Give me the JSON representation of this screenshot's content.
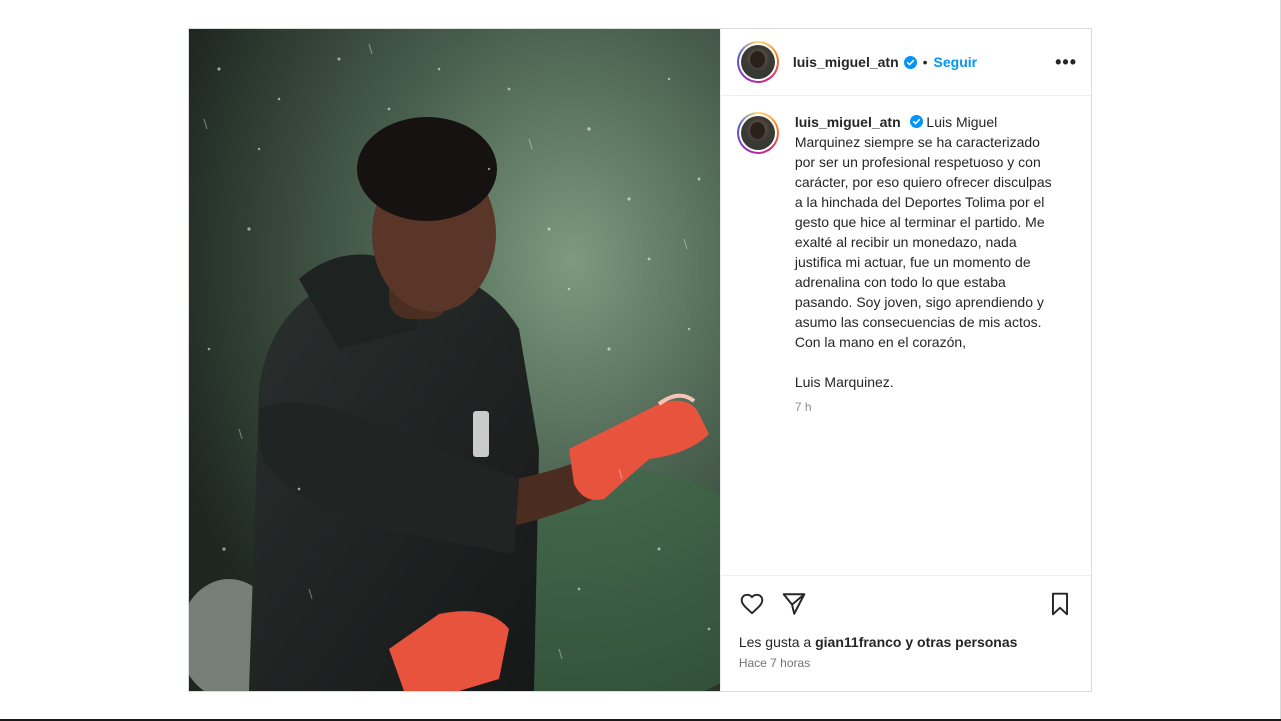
{
  "post": {
    "media": {
      "alt_icon": "photo-goalkeeper-in-rain"
    },
    "header": {
      "username": "luis_miguel_atn",
      "separator": "•",
      "follow_label": "Seguir",
      "more_icon": "more-horizontal-icon",
      "verified_icon": "verified-badge-icon"
    },
    "caption": {
      "username": "luis_miguel_atn",
      "text": "Luis Miguel Marquinez siempre se ha caracterizado por ser un profesional respetuoso y con carácter, por eso quiero ofrecer disculpas a la hinchada del Deportes Tolima por el gesto que hice al terminar el partido. Me exalté al recibir un monedazo, nada justifica mi actuar, fue un momento de adrenalina con todo lo que estaba pasando. Soy joven, sigo aprendiendo y asumo las consecuencias de mis actos. Con la mano en el corazón,",
      "signature": "Luis Marquinez.",
      "time_ago": "7 h"
    },
    "actions": {
      "like_icon": "heart-icon",
      "share_icon": "paper-plane-icon",
      "save_icon": "bookmark-icon"
    },
    "likes": {
      "prefix": "Les gusta a",
      "user": "gian11franco",
      "suffix": "y otras personas"
    },
    "posted": "Hace 7 horas",
    "colors": {
      "follow": "#0095f6",
      "verified": "#0095f6",
      "glove": "#e8533e"
    }
  }
}
